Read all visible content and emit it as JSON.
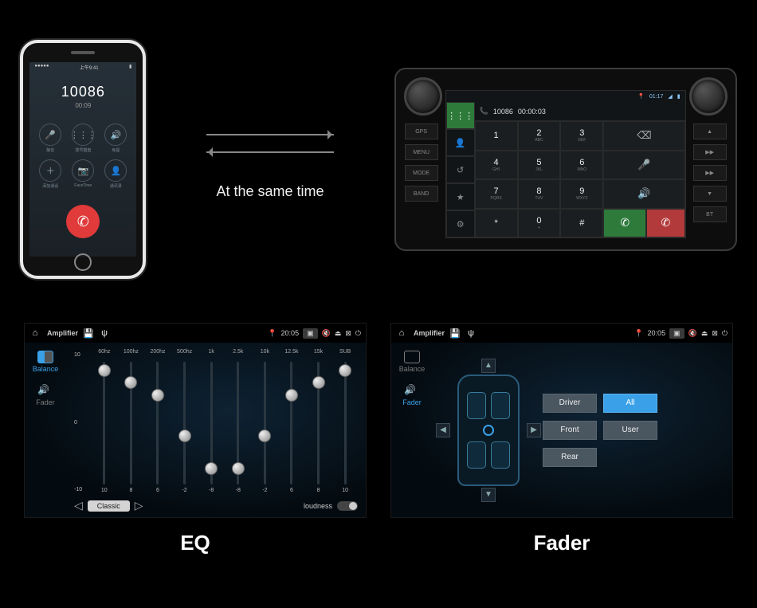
{
  "phone": {
    "status_left": "●●●●●",
    "status_mid": "上午9:41",
    "number": "10086",
    "duration": "00:09",
    "buttons": [
      {
        "icon": "🎤",
        "label": "静音"
      },
      {
        "icon": "⋮⋮⋮",
        "label": "拨号键盘"
      },
      {
        "icon": "🔊",
        "label": "免提"
      },
      {
        "icon": "＋",
        "label": "添加通话"
      },
      {
        "icon": "📷",
        "label": "FaceTime"
      },
      {
        "icon": "👤",
        "label": "通讯录"
      }
    ]
  },
  "center_caption": "At the same time",
  "hu": {
    "side_left": [
      "GPS",
      "MENU",
      "MODE",
      "BAND"
    ],
    "side_right": [
      "▲",
      "▶▶",
      "▶▶",
      "▼",
      "BT"
    ],
    "status_time": "01:17",
    "number": "10086",
    "duration": "00:00:03",
    "keys": [
      {
        "n": "1",
        "s": ""
      },
      {
        "n": "2",
        "s": "ABC"
      },
      {
        "n": "3",
        "s": "DEF"
      },
      {
        "n": "⌫",
        "s": "",
        "cls": "icon"
      },
      {
        "n": "4",
        "s": "GHI"
      },
      {
        "n": "5",
        "s": "JKL"
      },
      {
        "n": "6",
        "s": "MNO"
      },
      {
        "n": "🎤",
        "s": "",
        "cls": "icon"
      },
      {
        "n": "7",
        "s": "PQRS"
      },
      {
        "n": "8",
        "s": "TUV"
      },
      {
        "n": "9",
        "s": "WXYZ"
      },
      {
        "n": "🔊",
        "s": "",
        "cls": "icon"
      },
      {
        "n": "*",
        "s": ""
      },
      {
        "n": "0",
        "s": "+"
      },
      {
        "n": "#",
        "s": ""
      },
      {
        "n": "✆",
        "s": "",
        "cls": "green"
      },
      {
        "n": "✆",
        "s": "",
        "cls": "red"
      }
    ]
  },
  "amp_title": "Amplifier",
  "amp_time": "20:05",
  "nav": {
    "balance": "Balance",
    "fader": "Fader"
  },
  "eq": {
    "scale": [
      "10",
      "0",
      "-10"
    ],
    "bands": [
      {
        "f": "60hz",
        "v": 10,
        "pos": 2
      },
      {
        "f": "100hz",
        "v": 8,
        "pos": 12
      },
      {
        "f": "200hz",
        "v": 6,
        "pos": 22
      },
      {
        "f": "500hz",
        "v": -2,
        "pos": 55
      },
      {
        "f": "1k",
        "v": -8,
        "pos": 82
      },
      {
        "f": "2.5k",
        "v": -8,
        "pos": 82
      },
      {
        "f": "10k",
        "v": -2,
        "pos": 55
      },
      {
        "f": "12.5k",
        "v": 6,
        "pos": 22
      },
      {
        "f": "15k",
        "v": 8,
        "pos": 12
      },
      {
        "f": "SUB",
        "v": 10,
        "pos": 2
      }
    ],
    "preset": "Classic",
    "loudness_label": "loudness"
  },
  "fader": {
    "presets_left": [
      "Driver",
      "Front",
      "Rear"
    ],
    "presets_right": [
      "All",
      "User"
    ],
    "selected": "All"
  },
  "captions": {
    "eq": "EQ",
    "fader": "Fader"
  }
}
